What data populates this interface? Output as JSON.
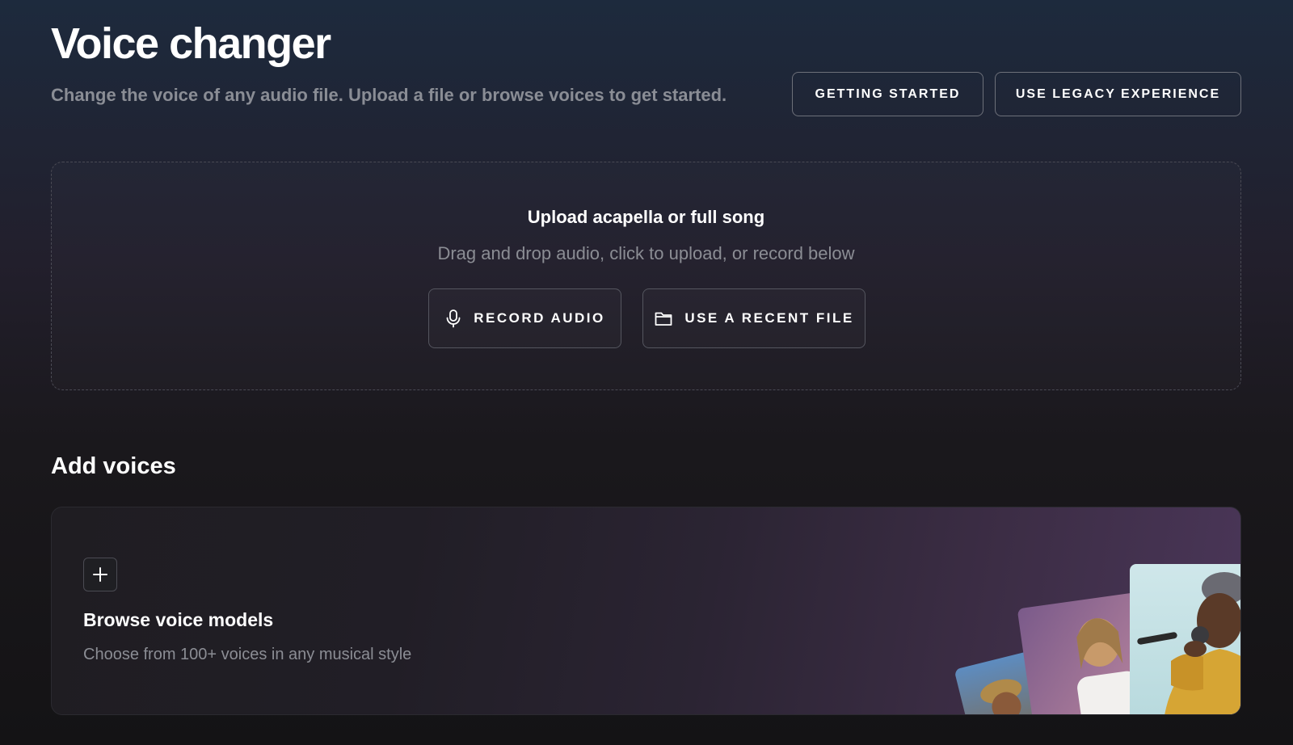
{
  "header": {
    "title": "Voice changer",
    "subtitle": "Change the voice of any audio file. Upload a file or browse voices to get started.",
    "getting_started_label": "GETTING STARTED",
    "legacy_label": "USE LEGACY EXPERIENCE"
  },
  "upload": {
    "title": "Upload acapella or full song",
    "subtitle": "Drag and drop audio, click to upload, or record below",
    "record_label": "RECORD AUDIO",
    "record_icon": "microphone-icon",
    "recent_label": "USE A RECENT FILE",
    "recent_icon": "folder-icon"
  },
  "add_voices": {
    "section_title": "Add voices",
    "card_icon": "plus-icon",
    "card_title": "Browse voice models",
    "card_subtitle": "Choose from 100+ voices in any musical style"
  },
  "colors": {
    "background_top": "#1d2a3d",
    "background_bottom": "#141315",
    "muted_text": "#8b8d94",
    "card_accent": "#4a3658"
  }
}
